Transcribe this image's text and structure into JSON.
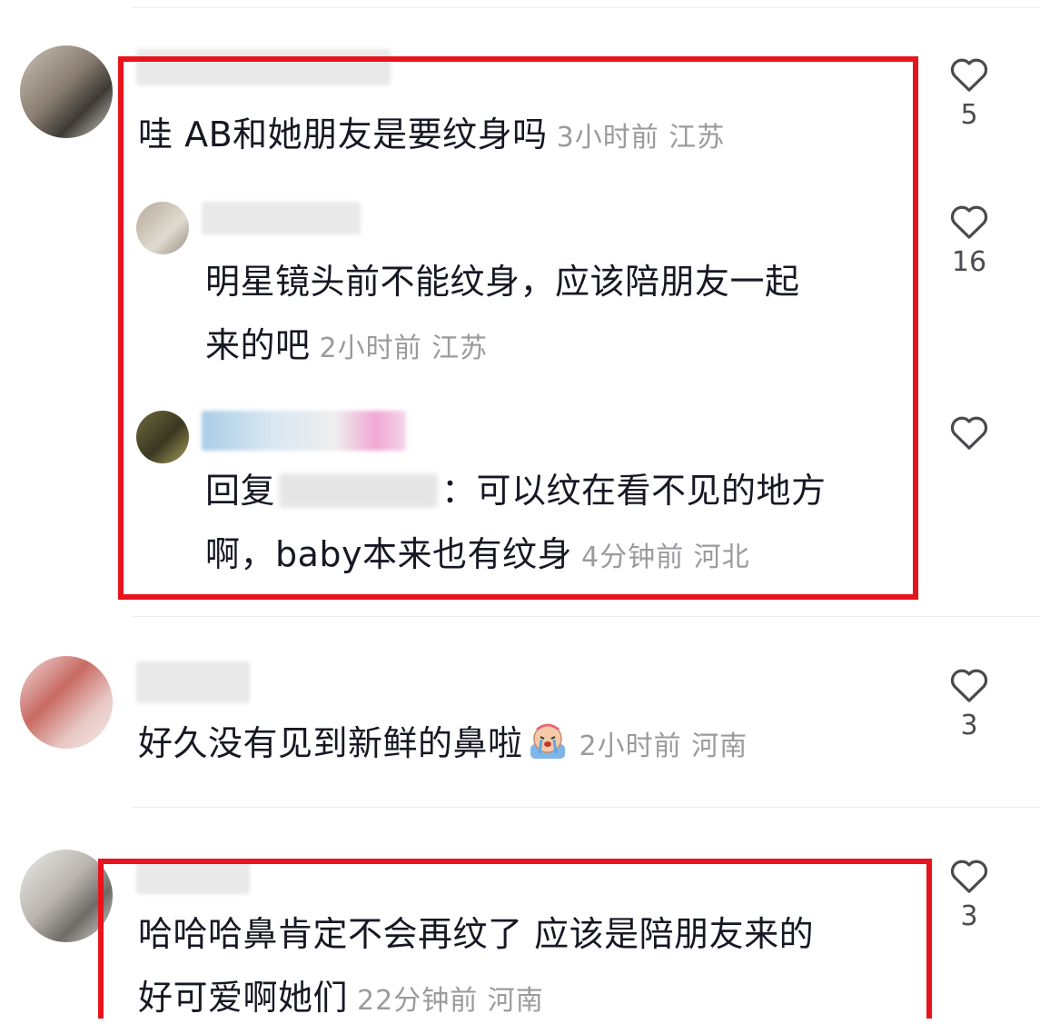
{
  "comments": [
    {
      "text": "哇 AB和她朋友是要纹身吗",
      "meta": "3小时前 江苏",
      "likes": "5",
      "replies": [
        {
          "text_line1": "明星镜头前不能纹身，应该陪朋友一起",
          "text_line2": "来的吧",
          "meta": "2小时前 江苏",
          "likes": "16"
        },
        {
          "reply_prefix": "回复",
          "text_line1": "：可以纹在看不见的地方",
          "text_line2": "啊，baby本来也有纹身",
          "meta": "4分钟前 河北",
          "likes": ""
        }
      ]
    },
    {
      "text": "好久没有见到新鲜的鼻啦",
      "meta": "2小时前 河南",
      "likes": "3",
      "emoji": "crying-face-emoji"
    },
    {
      "text_line1": "哈哈哈鼻肯定不会再纹了 应该是陪朋友来的",
      "text_line2": "好可爱啊她们",
      "meta": "22分钟前 河南",
      "likes": "3"
    }
  ],
  "icons": {
    "like": "heart-outline-icon"
  },
  "colors": {
    "highlight": "#e8141d",
    "meta_text": "#9a9a9f",
    "body_text": "#161823"
  }
}
